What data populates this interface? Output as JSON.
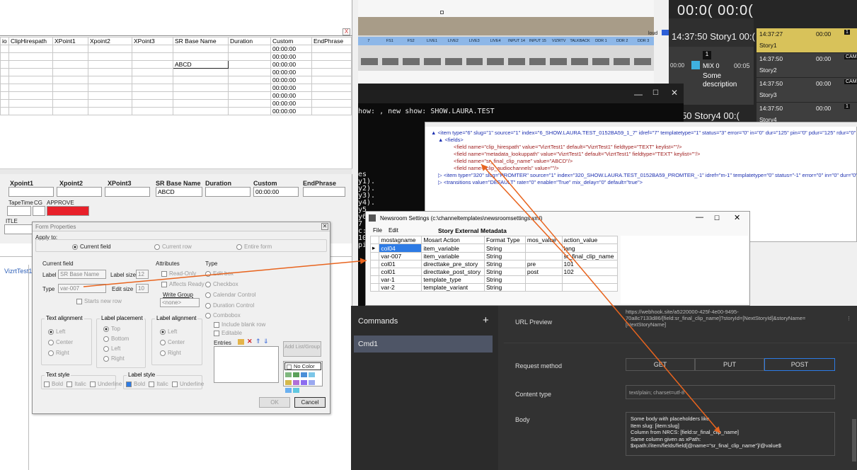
{
  "top_grid": {
    "columns": [
      "io",
      "ClipHirespath",
      "XPoint1",
      "Xpoint2",
      "XPoint3",
      "SR Base Name",
      "Duration",
      "Custom",
      "EndPhrase"
    ],
    "custom_values": [
      "00:00:00",
      "00:00:00",
      "00:00:00",
      "00:00:00",
      "00:00:00",
      "00:00:00",
      "00:00:00",
      "00:00:00",
      "00:00:00"
    ],
    "sr_base_value": "ABCD",
    "close": "X"
  },
  "mid_grid": {
    "headers": [
      "Xpoint1",
      "Xpoint2",
      "XPoint3",
      "SR Base Name",
      "Duration",
      "Custom",
      "EndPhrase"
    ],
    "sr_value": "ABCD",
    "custom_value": "00:00:00",
    "row2": [
      "TapeTime",
      "CG",
      "APPROVE"
    ],
    "row3": "ITLE",
    "left_cell": "VizrtTest1"
  },
  "form_properties": {
    "title": "Form Properties",
    "apply_to": "Apply to:",
    "apply_options": [
      "Current field",
      "Current row",
      "Entire form"
    ],
    "current_field": "Current field",
    "label_label": "Label",
    "label_value": "SR Base Name",
    "label_size_label": "Label size",
    "label_size_value": "12",
    "type_label": "Type",
    "type_value": "var-007",
    "edit_size_label": "Edit size",
    "edit_size_value": "10",
    "starts_new_row": "Starts new row",
    "attributes_title": "Attributes",
    "attributes": [
      "Read-Only",
      "Affects Ready"
    ],
    "write_group": "Write Group",
    "write_group_value": "<none>",
    "type_title": "Type",
    "types": [
      "Edit box",
      "Checkbox",
      "Calendar Control",
      "Duration Control",
      "Combobox"
    ],
    "include_blank": "Include blank row",
    "editable": "Editable",
    "entries": "Entries",
    "add_list": "Add List/Group",
    "no_color": "No Color",
    "text_alignment": "Text alignment",
    "text_align_opts": [
      "Left",
      "Center",
      "Right"
    ],
    "label_placement": "Label placement",
    "label_place_opts": [
      "Top",
      "Bottom",
      "Left",
      "Right"
    ],
    "label_alignment": "Label alignment",
    "label_align_opts": [
      "Left",
      "Center",
      "Right"
    ],
    "text_style": "Text style",
    "label_style": "Label style",
    "style_opts": [
      "Bold",
      "Italic",
      "Underline"
    ],
    "ok": "OK",
    "cancel": "Cancel",
    "swatches": [
      "#7fb77e",
      "#5aa05a",
      "#4a8fd8",
      "#7cc6e8",
      "#d4b84a",
      "#b070d8",
      "#8c6cf0",
      "#9aa8f0",
      "#6ab0f0",
      "#60c8e0"
    ]
  },
  "switcher": {
    "buttons": [
      "7",
      "FS1",
      "FS2",
      "LIVE1",
      "LIVE2",
      "LIVE3",
      "LIVE4",
      "INPUT 14",
      "INPUT 15",
      "VIZRTV",
      "TALKBACK",
      "DDR 1",
      "DDR 2",
      "DDR 3"
    ],
    "loud": "loud"
  },
  "timecode": "00:0( 00:0(",
  "rundown": {
    "rows": [
      {
        "time": "14:37:50",
        "name": "Story1",
        "dur": "00:("
      },
      {
        "time": "",
        "name": "",
        "dur": ""
      },
      {
        "time": "37:50",
        "name": "Story4",
        "dur": "00:("
      }
    ],
    "item_num": "1",
    "item_prefix": "00:00",
    "mix": "MIX 0",
    "mix_dur": "00:05",
    "desc1": "Some",
    "desc2": "description",
    "side": [
      {
        "time": "14:37:27",
        "name": "Story1",
        "dur": "00:00",
        "num": "1"
      },
      {
        "time": "14:37:50",
        "name": "Story2",
        "dur": "00:00",
        "num": "CAM"
      },
      {
        "time": "14:37:50",
        "name": "Story3",
        "dur": "00:00",
        "num": "CAM"
      },
      {
        "time": "14:37:50",
        "name": "Story4",
        "dur": "00:00",
        "num": "1"
      }
    ]
  },
  "console": {
    "line1": "how: , new show: SHOW.LAURA.TEST",
    "lines": [
      "es",
      "y1).",
      "y2).",
      "y3).",
      "y4).",
      "y5",
      "y6",
      "7",
      "c:",
      "10",
      "pi"
    ]
  },
  "xml": {
    "line1": "<item type=\"6\" slug=\"1\" source=\"1\" index=\"6_SHOW.LAURA.TEST_0152BA59_1_7\" idref=\"7\" templatetype=\"1\" status=\"3\" error=\"0\" in=\"0\" dur=\"125\" pin=\"0\" pdur=\"125\" rdur=\"0\" ext",
    "fields": "<fields>",
    "f1": "<field name=\"clip_hirespath\" value=\"VizrtTest1\" default=\"VizrtTest1\" fieldtype=\"TEXT\" keylist=\"\"/>",
    "f2": "<field name=\"metadata_lookuppath\" value=\"VizrtTest1\" default=\"VizrtTest1\" fieldtype=\"TEXT\" keylist=\"\"/>",
    "f3": "<field name=\"sr_final_clip_name\" value=\"ABCD\"/>",
    "f4": "<field name=\"clip_audiochannels\" value=\"\"/>",
    "line6": "<item type=\"320\" slug=\"PROMTER\" source=\"1\" index=\"320_SHOW.LAURA.TEST_0152BA59_PROMTER_-1\" idref=\"m-1\" templatetype=\"0\" status=\"-1\" error=\"0\" in=\"0\" dur=\"0\" pin=\"",
    "line7": "<transitions value=\"DEFAULT\" rate=\"0\" enable=\"True\" mix_delay=\"0\" default=\"true\">"
  },
  "newsroom": {
    "title": "Newsroom Settings (c:\\channeltemplates\\newsroomsettings.xml)",
    "menu": [
      "File",
      "Edit"
    ],
    "heading": "Story External Metadata",
    "columns": [
      "mostagname",
      "Mosart Action",
      "Format Type",
      "mos_value",
      "action_value"
    ],
    "rows": [
      [
        "col04",
        "item_variable",
        "String",
        "",
        "lang"
      ],
      [
        "var-007",
        "item_variable",
        "String",
        "",
        "sr_final_clip_name"
      ],
      [
        "col01",
        "directtake_pre_story",
        "String",
        "pre",
        "101"
      ],
      [
        "col01",
        "directtake_post_story",
        "String",
        "post",
        "102"
      ],
      [
        "var-1",
        "template_type",
        "String",
        "",
        ""
      ],
      [
        "var-2",
        "template_variant",
        "String",
        "",
        ""
      ]
    ]
  },
  "commands": {
    "title": "Commands",
    "add": "+",
    "item": "Cmd1",
    "url_preview_label": "URL Preview",
    "url_text": "https://webhook.site/a5220000-425f-4e00-9495-70a8c7133d86/[field:sr_final_clip_name]?storyId=[NextStoryId]&storyName=[NextStoryName]",
    "request_method_label": "Request method",
    "methods": [
      "GET",
      "PUT",
      "POST"
    ],
    "content_type_label": "Content type",
    "content_type_value": "text/plain; charset=utf-8",
    "body_label": "Body",
    "body_lines": [
      "Some body with placeholders like",
      "Item slug: [item:slug]",
      "Column from NRCS: [field:sr_final_clip_name]",
      "Same column given as xPath:",
      "$xpath://item/fields/field[@name=\"sr_final_clip_name\"]/@value$"
    ]
  },
  "colors": {
    "accent": "#2d7be5",
    "arrow": "#e8641e",
    "rundown_yellow": "#d8c25a",
    "approve_red": "#e8202a"
  }
}
